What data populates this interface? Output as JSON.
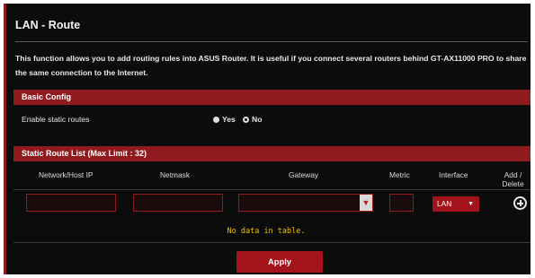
{
  "page": {
    "title": "LAN - Route",
    "description": "This function allows you to add routing rules into ASUS Router. It is useful if you connect several routers behind GT-AX11000 PRO to share the same connection to the Internet."
  },
  "basic_config": {
    "header": "Basic Config",
    "enable_static_routes_label": "Enable static routes",
    "options": [
      {
        "label": "Yes",
        "selected": false
      },
      {
        "label": "No",
        "selected": true
      }
    ]
  },
  "static_route_list": {
    "header": "Static Route List (Max Limit : 32)",
    "columns": [
      "Network/Host IP",
      "Netmask",
      "Gateway",
      "Metric",
      "Interface",
      "Add / Delete"
    ],
    "inputs": {
      "network_ip": "",
      "netmask": "",
      "gateway": "",
      "metric": "",
      "interface_selected": "LAN"
    },
    "empty_message": "No data in table."
  },
  "actions": {
    "apply_label": "Apply"
  },
  "colors": {
    "accent": "#8f1b1f",
    "button": "#a3131c",
    "empty_text": "#e8c000",
    "background": "#0c0c0c"
  },
  "icons": {
    "add": "plus-circle-icon",
    "dropdown": "caret-down-icon",
    "radio": "radio-dot-icon"
  }
}
